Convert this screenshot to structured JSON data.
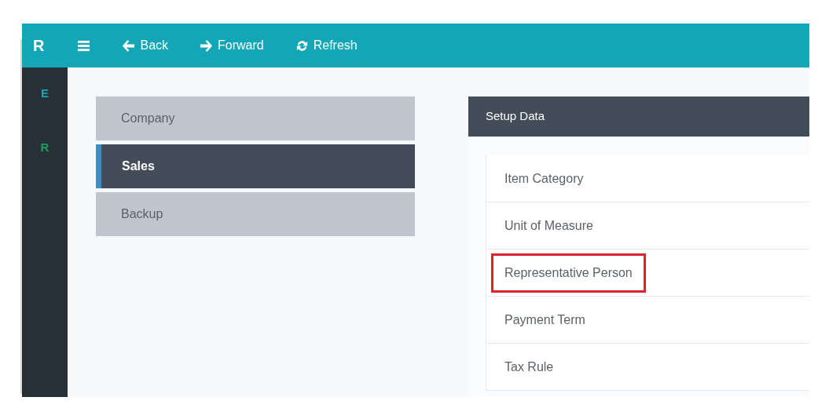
{
  "topbar": {
    "logo": "R",
    "buttons": [
      {
        "kind": "menu"
      },
      {
        "kind": "back",
        "label": "Back"
      },
      {
        "kind": "forward",
        "label": "Forward"
      },
      {
        "kind": "refresh",
        "label": "Refresh"
      }
    ]
  },
  "sidebar": {
    "items": [
      {
        "label": "E",
        "color": "#1aa3b2"
      },
      {
        "label": "R",
        "color": "#1f9d5c"
      }
    ]
  },
  "menu": {
    "items": [
      {
        "label": "Company",
        "selected": false
      },
      {
        "label": "Sales",
        "selected": true
      },
      {
        "label": "Backup",
        "selected": false
      }
    ]
  },
  "panel": {
    "title": "Setup Data",
    "items": [
      {
        "label": "Item Category",
        "highlighted": false
      },
      {
        "label": "Unit of Measure",
        "highlighted": false
      },
      {
        "label": "Representative Person",
        "highlighted": true
      },
      {
        "label": "Payment Term",
        "highlighted": false
      },
      {
        "label": "Tax Rule",
        "highlighted": false
      }
    ]
  }
}
